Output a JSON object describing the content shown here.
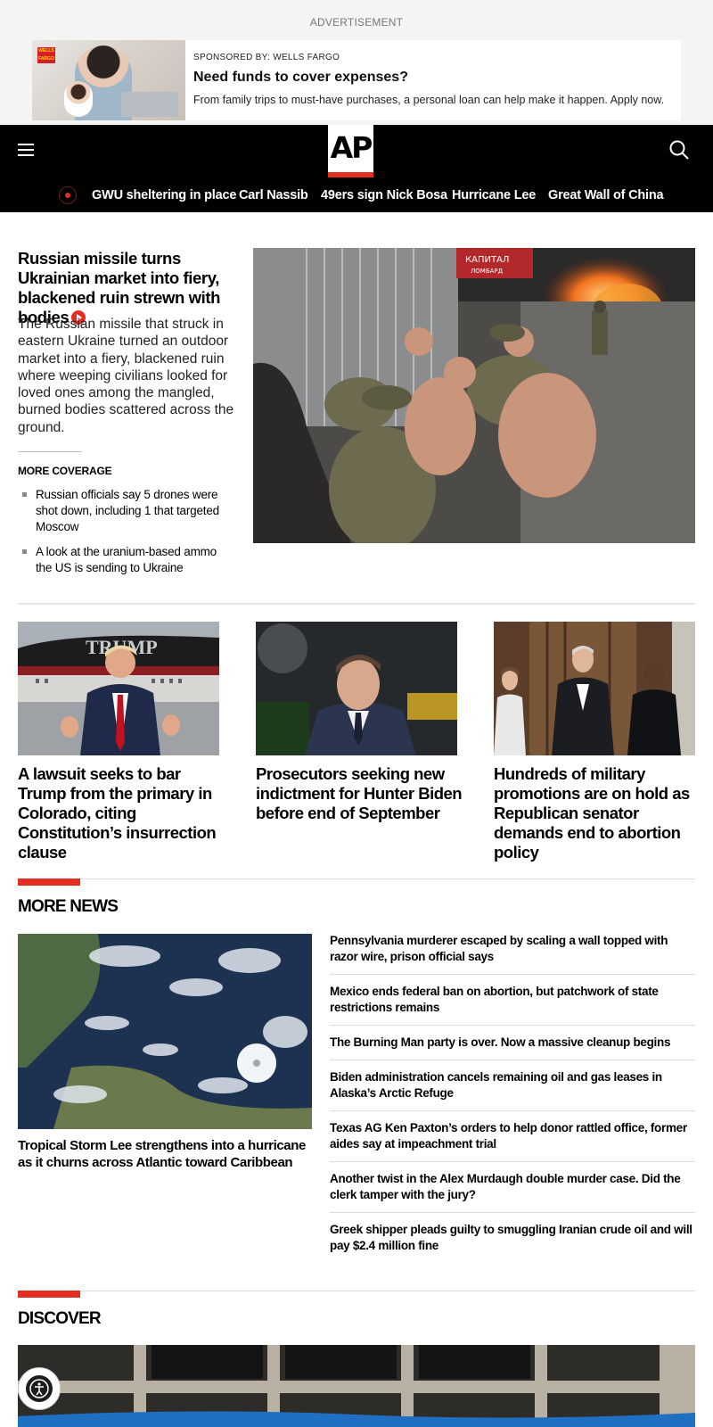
{
  "ad": {
    "label": "ADVERTISEMENT",
    "sponsor": "SPONSORED BY: WELLS FARGO",
    "headline": "Need funds to cover expenses?",
    "description": "From family trips to must-have purchases, a personal loan can help make it happen. Apply now.",
    "logo_text": "WELLS FARGO"
  },
  "header": {
    "logo": "AP",
    "trending": [
      "GWU sheltering in place",
      "Carl Nassib",
      "49ers sign Nick Bosa",
      "Hurricane Lee",
      "Great Wall of China"
    ]
  },
  "lead": {
    "title": "Russian missile turns Ukrainian market into fiery, blackened ruin strewn with bodies",
    "description": "The Russian missile that struck in eastern Ukraine turned an outdoor market into a fiery, blackened ruin where weeping civilians looked for loved ones among the mangled, burned bodies scattered across the ground.",
    "image_sign": "КАПИТАЛ",
    "image_sign2": "ЛОМБАРД",
    "more_coverage_label": "MORE COVERAGE",
    "more_coverage": [
      "Russian officials say 5 drones were shot down, including 1 that targeted Moscow",
      "A look at the uranium-based ammo the US is sending to Ukraine"
    ]
  },
  "cards": [
    {
      "title": "A lawsuit seeks to bar Trump from the primary in Colorado, citing Constitution’s insurrection clause",
      "image_text": "TRUMP"
    },
    {
      "title": "Prosecutors seeking new indictment for Hunter Biden before end of September"
    },
    {
      "title": "Hundreds of military promotions are on hold as Republican senator demands end to abortion policy"
    }
  ],
  "more_news": {
    "title": "MORE NEWS",
    "feature_caption": "Tropical Storm Lee strengthens into a hurricane as it churns across Atlantic toward Caribbean",
    "items": [
      "Pennsylvania murderer escaped by scaling a wall topped with razor wire, prison official says",
      "Mexico ends federal ban on abortion, but patchwork of state restrictions remains",
      "The Burning Man party is over. Now a massive cleanup begins",
      "Biden administration cancels remaining oil and gas leases in Alaska’s Arctic Refuge",
      "Texas AG Ken Paxton’s orders to help donor rattled office, former aides say at impeachment trial",
      "Another twist in the Alex Murdaugh double murder case. Did the clerk tamper with the jury?",
      "Greek shipper pleads guilty to smuggling Iranian crude oil and will pay $2.4 million fine"
    ]
  },
  "discover": {
    "title": "DISCOVER"
  },
  "colors": {
    "brand_red": "#e62d22",
    "header_bg": "#000000"
  },
  "icons": [
    "menu-icon",
    "search-icon",
    "live-icon",
    "play-icon",
    "accessibility-icon"
  ]
}
